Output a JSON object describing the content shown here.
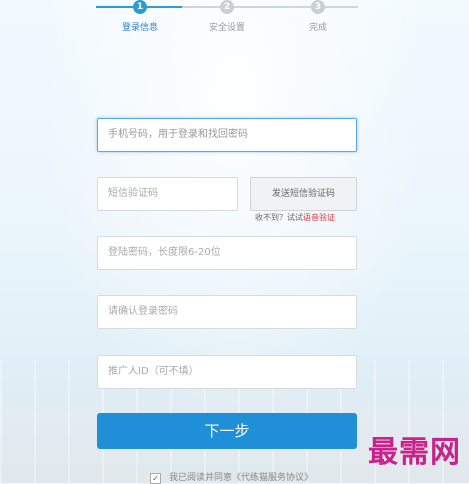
{
  "steps": [
    {
      "num": "1",
      "label": "登录信息",
      "active": true
    },
    {
      "num": "2",
      "label": "安全设置",
      "active": false
    },
    {
      "num": "3",
      "label": "完成",
      "active": false
    }
  ],
  "form": {
    "phone_placeholder": "手机号码，用于登录和找回密码",
    "sms_placeholder": "短信验证码",
    "send_sms_label": "发送短信验证码",
    "hint_prefix": "收不到？试试",
    "hint_link": "语音验证",
    "password_placeholder": "登陆密码，长度限6-20位",
    "confirm_placeholder": "请确认登录密码",
    "referrer_placeholder": "推广人ID（可不填）",
    "next_label": "下一步",
    "agree_text": "我已阅读并同意《代练猫服务协议》",
    "agree_check": "✓"
  },
  "watermark": "最需网",
  "colors": {
    "accent": "#1f8fd8",
    "link_red": "#d9363e",
    "watermark": "#c8238a"
  }
}
